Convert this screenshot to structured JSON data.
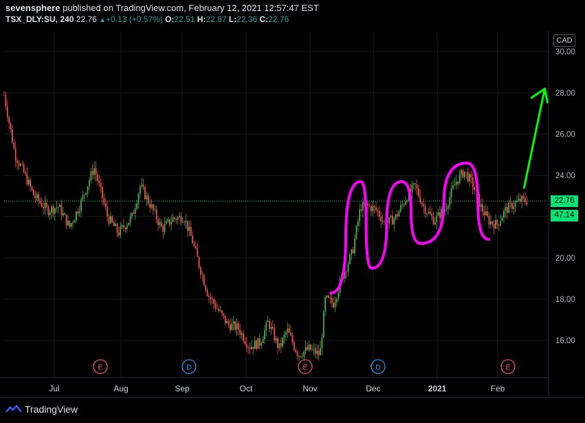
{
  "header": {
    "author": "sevensphere",
    "published": " published on TradingView.com, February 12, 2021 12:57:47 EST",
    "symbol": "TSX_DLY:SU, 240",
    "last": "22.76",
    "change": "+0.13 (+0.57%)",
    "o_label": "O:",
    "o_val": "22.51",
    "h_label": "H:",
    "h_val": "22.87",
    "l_label": "L:",
    "l_val": "22.36",
    "c_label": "C:",
    "c_val": "22.76"
  },
  "currency": "CAD",
  "price_tag": "22.76",
  "countdown_tag": "47:14",
  "footer": {
    "brand": "TradingView"
  },
  "colors": {
    "up": "#26a69a",
    "bull_candle": "#4caf50",
    "bear_candle": "#ef5350",
    "annotation_magenta": "#ff00ff",
    "annotation_green": "#00ff00",
    "price_line": "#00e676"
  },
  "chart_data": {
    "type": "candlestick",
    "y_ticks": [
      "30.00",
      "28.00",
      "26.00",
      "24.00",
      "22.00",
      "20.00",
      "18.00",
      "16.00"
    ],
    "y_values": [
      30,
      28,
      26,
      24,
      22,
      20,
      18,
      16
    ],
    "ylim": [
      14.2,
      31
    ],
    "x_ticks": [
      "Jul",
      "Aug",
      "Sep",
      "Oct",
      "Nov",
      "Dec",
      "2021",
      "Feb"
    ],
    "events": [
      {
        "label": "E",
        "after_tick": "Jul"
      },
      {
        "label": "D",
        "after_tick": "Aug"
      },
      {
        "label": "E",
        "after_tick": "Oct"
      },
      {
        "label": "D",
        "after_tick": "Nov"
      },
      {
        "label": "E",
        "after_tick": "Feb"
      }
    ],
    "current_price": 22.76,
    "price_path": [
      [
        0,
        27.9
      ],
      [
        0.02,
        25.0
      ],
      [
        0.035,
        24.2
      ],
      [
        0.055,
        23.0
      ],
      [
        0.08,
        22.3
      ],
      [
        0.1,
        22.5
      ],
      [
        0.12,
        21.5
      ],
      [
        0.14,
        22.6
      ],
      [
        0.165,
        24.4
      ],
      [
        0.19,
        22.0
      ],
      [
        0.21,
        21.2
      ],
      [
        0.235,
        22.0
      ],
      [
        0.25,
        23.5
      ],
      [
        0.27,
        22.5
      ],
      [
        0.29,
        21.4
      ],
      [
        0.31,
        21.9
      ],
      [
        0.33,
        22.0
      ],
      [
        0.345,
        20.9
      ],
      [
        0.36,
        19.5
      ],
      [
        0.375,
        18.2
      ],
      [
        0.39,
        17.6
      ],
      [
        0.41,
        16.8
      ],
      [
        0.43,
        16.6
      ],
      [
        0.45,
        15.7
      ],
      [
        0.47,
        15.9
      ],
      [
        0.485,
        16.9
      ],
      [
        0.505,
        15.6
      ],
      [
        0.52,
        16.5
      ],
      [
        0.54,
        15.3
      ],
      [
        0.56,
        15.6
      ],
      [
        0.58,
        15.3
      ],
      [
        0.59,
        18.0
      ],
      [
        0.605,
        17.8
      ],
      [
        0.62,
        19.0
      ],
      [
        0.64,
        20.3
      ],
      [
        0.655,
        22.5
      ],
      [
        0.67,
        22.5
      ],
      [
        0.685,
        22.3
      ],
      [
        0.7,
        21.6
      ],
      [
        0.72,
        22.0
      ],
      [
        0.74,
        23.0
      ],
      [
        0.755,
        23.5
      ],
      [
        0.77,
        22.5
      ],
      [
        0.79,
        21.8
      ],
      [
        0.81,
        22.4
      ],
      [
        0.83,
        23.7
      ],
      [
        0.845,
        24.2
      ],
      [
        0.86,
        23.6
      ],
      [
        0.875,
        22.5
      ],
      [
        0.89,
        21.8
      ],
      [
        0.905,
        21.6
      ],
      [
        0.92,
        22.3
      ],
      [
        0.935,
        22.6
      ],
      [
        0.95,
        22.8
      ],
      [
        0.96,
        22.76
      ]
    ],
    "annotations": [
      {
        "type": "magenta-line",
        "points": [
          [
            0.6,
            18.3
          ],
          [
            0.655,
            23.7
          ],
          [
            0.675,
            19.5
          ],
          [
            0.73,
            23.7
          ],
          [
            0.765,
            20.7
          ],
          [
            0.85,
            24.6
          ],
          [
            0.89,
            20.9
          ]
        ]
      },
      {
        "type": "green-arrow",
        "points": [
          [
            0.955,
            23.4
          ],
          [
            0.993,
            28.2
          ]
        ]
      }
    ]
  }
}
